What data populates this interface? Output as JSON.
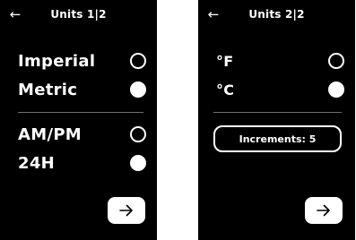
{
  "screen1": {
    "title": "Units 1|2",
    "back_glyph": "←",
    "options": [
      {
        "label": "Imperial",
        "selected": false
      },
      {
        "label": "Metric",
        "selected": true
      },
      {
        "label": "AM/PM",
        "selected": false
      },
      {
        "label": "24H",
        "selected": true
      }
    ],
    "icons": {
      "back": "back-arrow-icon",
      "next": "right-arrow-icon"
    }
  },
  "screen2": {
    "title": "Units 2|2",
    "back_glyph": "←",
    "options": [
      {
        "label": "°F",
        "selected": false
      },
      {
        "label": "°C",
        "selected": true
      }
    ],
    "increments_label": "Increments: 5",
    "icons": {
      "back": "back-arrow-icon",
      "next": "right-arrow-icon"
    }
  },
  "colors": {
    "background": "#000000",
    "foreground": "#ffffff",
    "divider": "#6f6f6f"
  }
}
